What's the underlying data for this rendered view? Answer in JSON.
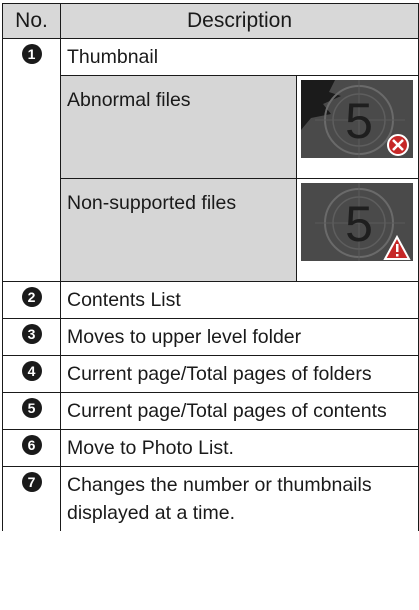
{
  "header": {
    "no": "No.",
    "description": "Description"
  },
  "rows": [
    {
      "num": "1",
      "text": "Thumbnail",
      "sub": [
        {
          "text": "Abnormal files",
          "thumb_label": "5",
          "thumb_icon": "error-x-icon"
        },
        {
          "text": "Non-supported files",
          "thumb_label": "5",
          "thumb_icon": "warning-triangle-icon"
        }
      ]
    },
    {
      "num": "2",
      "text": "Contents List"
    },
    {
      "num": "3",
      "text": "Moves to upper level folder"
    },
    {
      "num": "4",
      "text": "Current page/Total pages of folders"
    },
    {
      "num": "5",
      "text": "Current page/Total pages of contents"
    },
    {
      "num": "6",
      "text": "Move to Photo List."
    },
    {
      "num": "7",
      "text": "Changes the number or thumbnails displayed at a time."
    }
  ]
}
